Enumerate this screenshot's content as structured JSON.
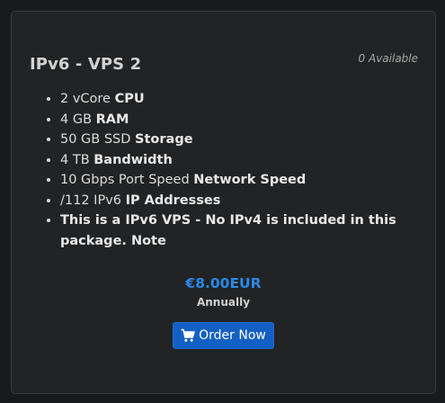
{
  "product": {
    "title": "IPv6 - VPS 2",
    "availability": "0 Available",
    "features": [
      {
        "value": "2 vCore",
        "label": "CPU"
      },
      {
        "value": "4 GB",
        "label": "RAM"
      },
      {
        "value": "50 GB SSD",
        "label": "Storage"
      },
      {
        "value": "4 TB",
        "label": "Bandwidth"
      },
      {
        "value": "10 Gbps Port Speed",
        "label": "Network Speed"
      },
      {
        "value": "/112 IPv6",
        "label": "IP Addresses"
      },
      {
        "value": "",
        "label": "This is a IPv6 VPS - No IPv4 is included in this package. Note"
      }
    ],
    "price": "€8.00EUR",
    "billing_cycle": "Annually",
    "order_button_label": "Order Now",
    "order_button_icon": "shopping-cart-icon"
  },
  "colors": {
    "page_background": "#191a1b",
    "card_background": "#222324",
    "price": "#2b87e8",
    "button": "#1360c4"
  }
}
